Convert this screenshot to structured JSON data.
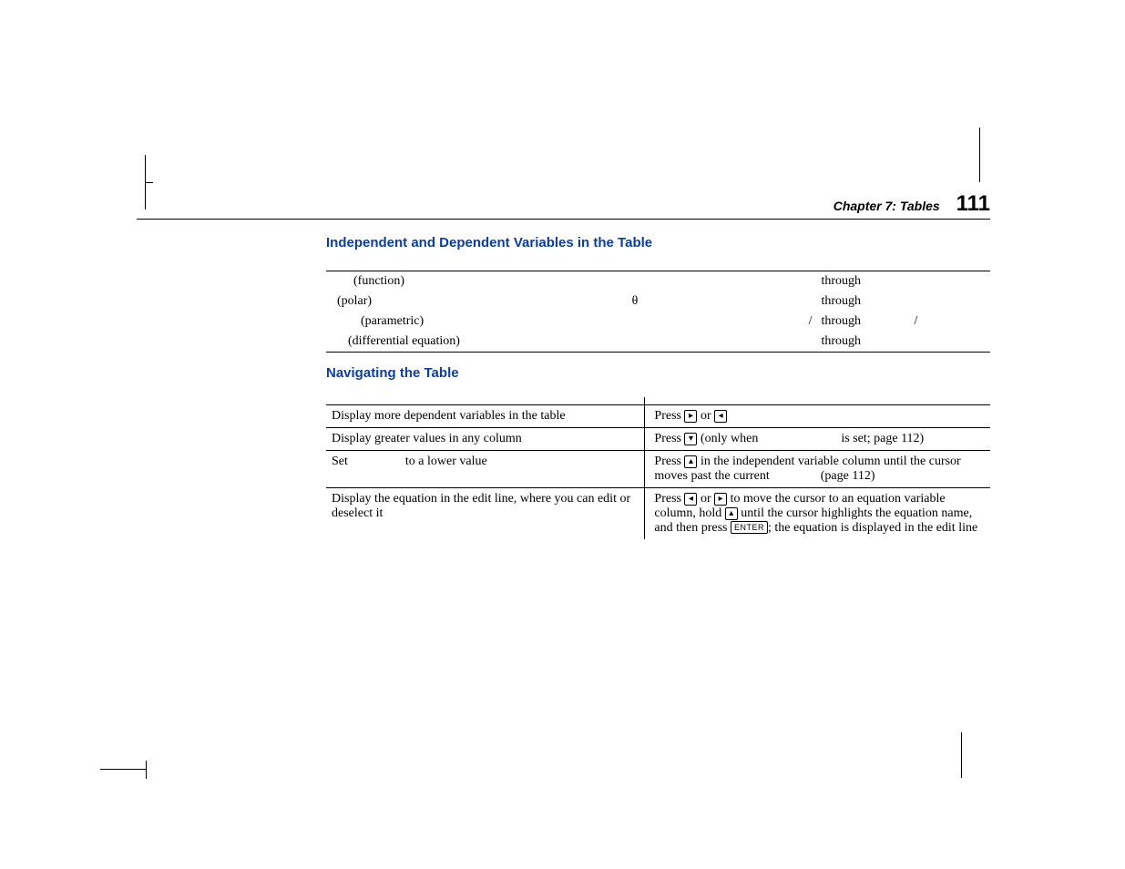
{
  "header": {
    "chapter": "Chapter 7: Tables",
    "page": "111"
  },
  "section1": {
    "title": "Independent and Dependent Variables in the Table",
    "rows": [
      {
        "c1": "(function)",
        "c2": "",
        "c3": "",
        "c4": "through",
        "c5": ""
      },
      {
        "c1": "(polar)",
        "c2": "θ",
        "c3": "",
        "c4": "through",
        "c5": ""
      },
      {
        "c1": "(parametric)",
        "c2": "",
        "c3": "/",
        "c4": "through",
        "c5": "/"
      },
      {
        "c1": "(differential equation)",
        "c2": "",
        "c3": "",
        "c4": "through",
        "c5": ""
      }
    ]
  },
  "section2": {
    "title": "Navigating the Table",
    "hd_left": "",
    "hd_right": "",
    "rows": [
      {
        "left": "Display more dependent variables in the table",
        "r_pre": "Press ",
        "k1": "▸",
        "r_mid": " or ",
        "k2": "◂",
        "r_post": ""
      },
      {
        "left": "Display greater values in any column",
        "r_pre": "Press ",
        "k1": "▾",
        "r_mid": " (only when ",
        "r_post": " is set; page 112)"
      },
      {
        "left_pre": "Set ",
        "left_mid": " to a lower value",
        "r_pre": "Press ",
        "k1": "▴",
        "r_mid": " in the independent variable column until the cursor moves past the current ",
        "r_post": " (page 112)"
      },
      {
        "left": "Display the equation in the edit line, where you can edit or deselect it",
        "r_pre": "Press ",
        "k1": "◂",
        "r_mid": " or ",
        "k2": "▸",
        "r_post1": " to move the cursor to an equation variable column, hold ",
        "k3": "▴",
        "r_post2": " until the cursor highlights the equation name, and then press ",
        "k4": "ENTER",
        "r_post3": "; the equation is displayed in the edit line"
      }
    ]
  }
}
